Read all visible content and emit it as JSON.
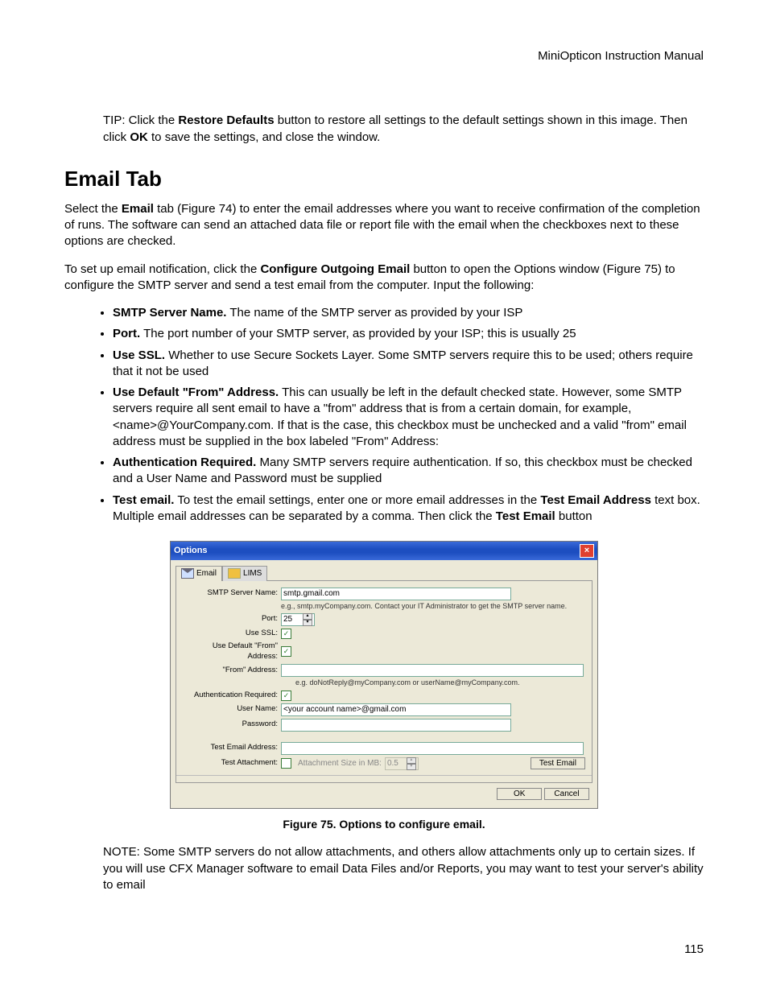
{
  "header": {
    "docTitle": "MiniOpticon Instruction Manual"
  },
  "tip": {
    "pre": "TIP: Click the ",
    "b1": "Restore Defaults",
    "mid": " button to restore all settings to the default settings shown in this image. Then click ",
    "b2": "OK",
    "post": " to save the settings, and close the window."
  },
  "sectionTitle": "Email Tab",
  "para1": {
    "pre": "Select the ",
    "b1": "Email",
    "post": " tab (Figure 74) to enter the email addresses where you want to receive confirmation of the completion of runs. The software can send an attached data file or report file with the email when the checkboxes next to these options are checked."
  },
  "para2": {
    "pre": "To set up email notification, click the ",
    "b1": "Configure Outgoing Email",
    "post": " button to open the Options window (Figure 75) to configure the SMTP server and send a test email from the computer. Input the following:"
  },
  "bullets": {
    "b1": {
      "head": "SMTP Server Name.",
      "tail": " The name of the SMTP server as provided by your ISP"
    },
    "b2": {
      "head": "Port.",
      "tail": " The port number of your SMTP server, as provided by your ISP; this is usually 25"
    },
    "b3": {
      "head": "Use SSL.",
      "tail": " Whether to use Secure Sockets Layer. Some SMTP servers require this to be used; others require that it not be used"
    },
    "b4": {
      "head": "Use Default \"From\" Address.",
      "tail": " This can usually be left in the default checked state. However, some SMTP servers require all sent email to have a \"from\" address that is from a certain domain, for example, <name>@YourCompany.com. If that is the case, this checkbox must be unchecked and a valid \"from\" email address must be supplied in the box labeled \"From\" Address:"
    },
    "b5": {
      "head": "Authentication Required.",
      "tail": " Many SMTP servers require authentication. If so, this checkbox must be checked and a User Name and Password must be supplied"
    },
    "b6": {
      "head": "Test email.",
      "t1": " To test the email settings, enter one or more email addresses in the ",
      "b6a": "Test Email Address",
      "t2": " text box. Multiple email addresses can be separated by a comma. Then click the ",
      "b6b": "Test Email",
      "t3": " button"
    }
  },
  "dialog": {
    "title": "Options",
    "tabs": {
      "email": "Email",
      "lims": "LIMS"
    },
    "labels": {
      "smtp": "SMTP Server Name:",
      "port": "Port:",
      "ssl": "Use SSL:",
      "defFrom": "Use Default \"From\" Address:",
      "fromAddr": "\"From\" Address:",
      "authReq": "Authentication Required:",
      "user": "User Name:",
      "pass": "Password:",
      "testAddr": "Test Email Address:",
      "testAtt": "Test Attachment:",
      "attSize": "Attachment Size in MB:"
    },
    "values": {
      "smtp": "smtp.gmail.com",
      "smtpHint": "e.g., smtp.myCompany.com. Contact your IT Administrator to get the SMTP server name.",
      "port": "25",
      "fromHint": "e.g. doNotReply@myCompany.com or userName@myCompany.com.",
      "user": "<your account name>@gmail.com",
      "attSize": "0.5"
    },
    "buttons": {
      "testEmail": "Test Email",
      "ok": "OK",
      "cancel": "Cancel"
    },
    "check": "✓"
  },
  "figCaption": "Figure 75. Options to configure email.",
  "note": "NOTE: Some SMTP servers do not allow attachments, and others allow attachments only up to certain sizes. If you will use CFX Manager software to email Data Files and/or Reports, you may want to test your server's ability to email",
  "pageNum": "115"
}
